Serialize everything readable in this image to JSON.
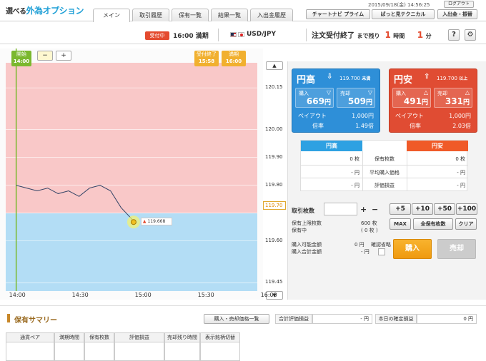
{
  "header": {
    "logo_small": "選べる",
    "logo_main": "外為オプション",
    "tabs": [
      "メイン",
      "取引履歴",
      "保有一覧",
      "結果一覧",
      "入出金履歴"
    ],
    "datetime": "2015/09/18(金) 14:56:25",
    "logout": "ログアウト",
    "links": [
      "チャートナビ プライム",
      "ばっと見テクニカル",
      "入出金・振替"
    ]
  },
  "subbar": {
    "status_badge": "受付中",
    "expiry": "16:00 満期",
    "pair": "USD/JPY",
    "status": "注文受付終了",
    "remaining_label": "まで残り",
    "hours": "1",
    "hours_unit": "時間",
    "minutes": "1",
    "minutes_unit": "分",
    "help": "?",
    "settings": "⚙"
  },
  "chart": {
    "start_label": "開始",
    "start_time": "14:00",
    "end_label": "受付終了",
    "end_time": "15:58",
    "maturity_label": "満期",
    "maturity_time": "16:00",
    "zoom_out": "−",
    "zoom_in": "+",
    "current_price": "119.70",
    "marker_price": "119.668",
    "up": "▲",
    "down": "▼"
  },
  "chart_data": {
    "type": "line",
    "x_ticks": [
      "14:00",
      "14:30",
      "15:00",
      "15:30",
      "16:00"
    ],
    "y_ticks": [
      "120.15",
      "120.00",
      "119.90",
      "119.80",
      "119.70",
      "119.60",
      "119.45"
    ],
    "strike": 119.7,
    "series": [
      {
        "values": [
          [
            0,
            119.8
          ],
          [
            5,
            119.79
          ],
          [
            10,
            119.78
          ],
          [
            15,
            119.79
          ],
          [
            20,
            119.77
          ],
          [
            25,
            119.78
          ],
          [
            30,
            119.76
          ],
          [
            35,
            119.79
          ],
          [
            40,
            119.8
          ],
          [
            45,
            119.78
          ],
          [
            50,
            119.72
          ],
          [
            55,
            119.68
          ],
          [
            56,
            119.668
          ]
        ]
      }
    ],
    "ylim": [
      119.42,
      120.24
    ],
    "xlim_minutes": [
      -5,
      115
    ]
  },
  "cards": {
    "yendaka": {
      "title": "円高",
      "arrow": "⇩",
      "price": "119.700",
      "cond": "未満",
      "buy_label": "購入",
      "buy_value": "669",
      "sell_label": "売却",
      "sell_value": "509",
      "unit": "円",
      "payout_label": "ペイアウト",
      "payout_value": "1,000円",
      "ratio_label": "倍率",
      "ratio_value": "1.49倍"
    },
    "yenyasu": {
      "title": "円安",
      "arrow": "⇧",
      "price": "119.700",
      "cond": "以上",
      "buy_label": "購入",
      "buy_value": "491",
      "sell_label": "売却",
      "sell_value": "331",
      "unit": "円",
      "payout_label": "ペイアウト",
      "payout_value": "1,000円",
      "ratio_label": "倍率",
      "ratio_value": "2.03倍"
    }
  },
  "info": {
    "head_left": "円高",
    "head_right": "円安",
    "rows": [
      {
        "left": "0 枚",
        "label": "保有枚数",
        "right": "0 枚"
      },
      {
        "left": "- 円",
        "label": "平均購入価格",
        "right": "- 円"
      },
      {
        "left": "- 円",
        "label": "評価損益",
        "right": "- 円"
      }
    ]
  },
  "trade": {
    "qty_label": "取引枚数",
    "plus": "+",
    "minus": "−",
    "quick": [
      "+5",
      "+10",
      "+50",
      "+100"
    ],
    "limit_label": "保有上限枚数",
    "limit_value": "600 枚",
    "pending_label": "保有中",
    "pending_value": "( 0 枚 )",
    "max": "MAX",
    "all": "全保有枚数",
    "clear": "クリア",
    "avail_label": "購入可能金額",
    "avail_value": "0 円",
    "total_label": "購入合計金額",
    "total_value": "- 円",
    "confirm_label": "確認省略",
    "buy": "購入",
    "sell": "売却"
  },
  "summary": {
    "title": "保有サマリー",
    "list_button": "購入・売却価格一覧",
    "eval_label": "合計評価損益",
    "eval_value": "- 円",
    "today_label": "本日の確定損益",
    "today_value": "0 円",
    "columns": [
      "通貨ペア",
      "満期時間",
      "保有枚数",
      "評価損益",
      "売却残り時間",
      "表示銘柄切替"
    ]
  }
}
